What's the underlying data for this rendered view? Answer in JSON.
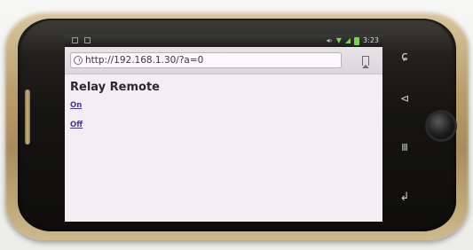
{
  "status_bar": {
    "time": "3:23"
  },
  "browser": {
    "url": "http://192.168.1.30/?a=0"
  },
  "page": {
    "title": "Relay Remote",
    "links": [
      {
        "label": "On"
      },
      {
        "label": "Off"
      }
    ]
  },
  "hardware_keys": [
    {
      "icon": "search-icon"
    },
    {
      "icon": "back-icon"
    },
    {
      "icon": "menu-icon"
    },
    {
      "icon": "home-icon"
    }
  ],
  "colors": {
    "link": "#4a3a8a",
    "status_green": "#7fd24b",
    "phone_body": "#b99e6c"
  }
}
